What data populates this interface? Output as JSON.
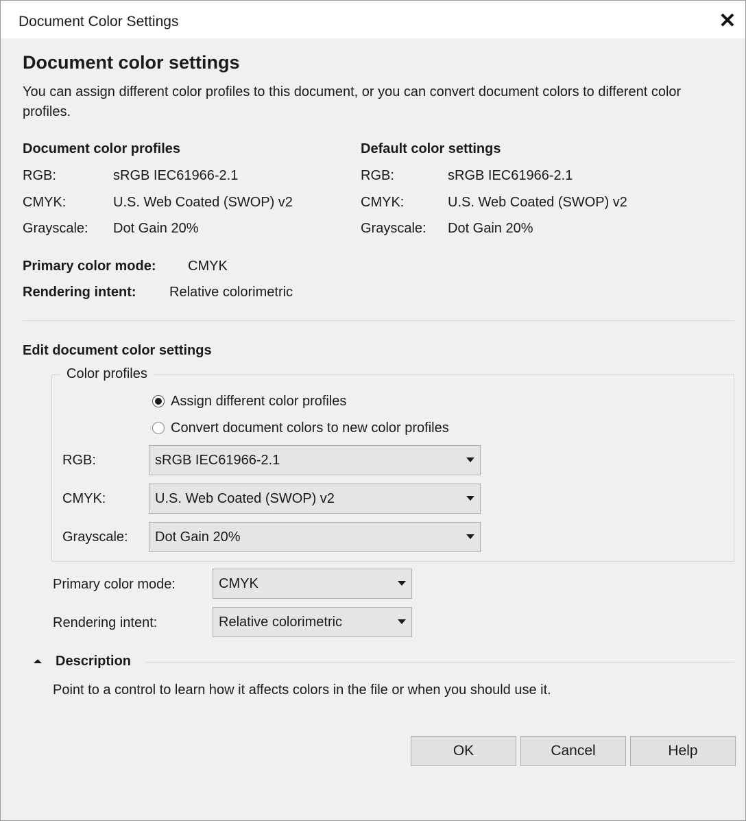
{
  "window": {
    "title": "Document Color Settings",
    "close_glyph": "✕"
  },
  "header": {
    "title": "Document color settings",
    "description": "You can assign different color profiles to this document, or you can convert document colors to different color profiles."
  },
  "document_profiles": {
    "heading": "Document color profiles",
    "rows": [
      {
        "label": "RGB:",
        "value": "sRGB IEC61966-2.1"
      },
      {
        "label": "CMYK:",
        "value": "U.S. Web Coated (SWOP) v2"
      },
      {
        "label": "Grayscale:",
        "value": "Dot Gain 20%"
      }
    ]
  },
  "default_settings": {
    "heading": "Default color settings",
    "rows": [
      {
        "label": "RGB:",
        "value": "sRGB IEC61966-2.1"
      },
      {
        "label": "CMYK:",
        "value": "U.S. Web Coated (SWOP) v2"
      },
      {
        "label": "Grayscale:",
        "value": "Dot Gain 20%"
      }
    ]
  },
  "summary": {
    "primary_mode_label": "Primary color mode:",
    "primary_mode_value": "CMYK",
    "rendering_intent_label": "Rendering intent:",
    "rendering_intent_value": "Relative colorimetric"
  },
  "edit": {
    "heading": "Edit document color settings",
    "group_label": "Color profiles",
    "radio_assign": "Assign different color profiles",
    "radio_convert": "Convert document colors to new color profiles",
    "selected_radio": "assign",
    "rgb_label": "RGB:",
    "rgb_value": "sRGB IEC61966-2.1",
    "cmyk_label": "CMYK:",
    "cmyk_value": "U.S. Web Coated (SWOP) v2",
    "gray_label": "Grayscale:",
    "gray_value": "Dot Gain 20%",
    "primary_mode_label": "Primary color mode:",
    "primary_mode_value": "CMYK",
    "rendering_intent_label": "Rendering intent:",
    "rendering_intent_value": "Relative colorimetric"
  },
  "description_panel": {
    "heading": "Description",
    "text": "Point to a control to learn how it affects colors in the file or when you should use it."
  },
  "buttons": {
    "ok": "OK",
    "cancel": "Cancel",
    "help": "Help"
  },
  "colors": {
    "dialog_bg": "#f0f0f0",
    "titlebar_bg": "#ffffff",
    "button_bg": "#e1e1e1"
  }
}
